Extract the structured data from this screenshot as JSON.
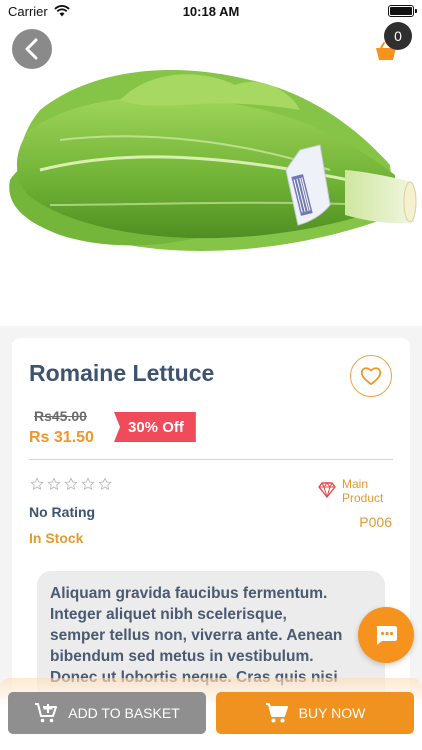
{
  "status_bar": {
    "carrier": "Carrier",
    "time": "10:18 AM",
    "battery_level": 1.0
  },
  "header": {
    "cart_count": "0"
  },
  "product": {
    "title": "Romaine Lettuce",
    "old_price": "Rs45.00",
    "new_price": "Rs 31.50",
    "discount": "30% Off",
    "rating_value": 0,
    "rating_max": 5,
    "rating_text": "No Rating",
    "stock": "In Stock",
    "main_product_label_line1": "Main",
    "main_product_label_line2": "Product",
    "code": "P006",
    "description": "Aliquam gravida faucibus fermentum.\nInteger aliquet nibh scelerisque,\nsemper tellus non, viverra ante. Aenean\nbibendum sed metus in vestibulum.\nDonec ut lobortis neque. Cras quis nisi"
  },
  "actions": {
    "add_to_basket": "ADD TO BASKET",
    "buy_now": "BUY NOW"
  },
  "colors": {
    "accent": "#f0921f",
    "title": "#3e5370",
    "discount": "#ef4b5a",
    "neutral_button": "#8f8f8f"
  }
}
